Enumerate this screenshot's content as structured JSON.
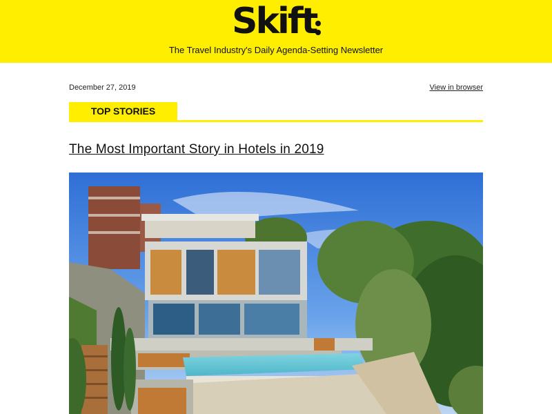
{
  "header": {
    "logo_text": "Skift",
    "tagline": "The Travel Industry's Daily Agenda-Setting Newsletter",
    "background": "#ffee00"
  },
  "meta": {
    "date": "December 27, 2019",
    "view_in_browser": "View in browser"
  },
  "section": {
    "label": "TOP STORIES"
  },
  "story": {
    "headline": "The Most Important Story in Hotels in 2019",
    "image_alt_icon": "hero-photo"
  }
}
